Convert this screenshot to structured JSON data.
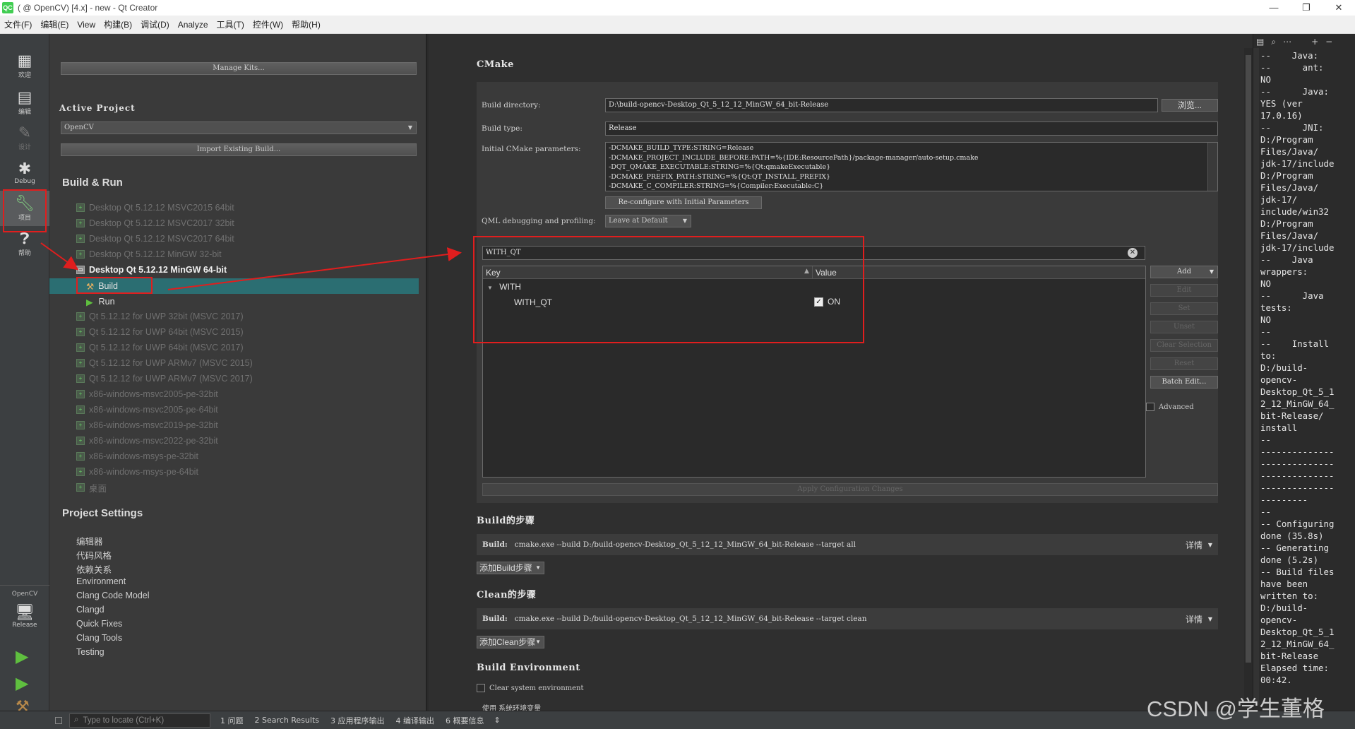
{
  "window": {
    "title": "( @ OpenCV) [4.x] - new - Qt Creator",
    "logo": "QC",
    "controls": [
      "—",
      "❐",
      "✕"
    ]
  },
  "menu": [
    "文件(F)",
    "编辑(E)",
    "View",
    "构建(B)",
    "调试(D)",
    "Analyze",
    "工具(T)",
    "控件(W)",
    "帮助(H)"
  ],
  "modes": {
    "welcome": "欢迎",
    "edit": "编辑",
    "design": "设计",
    "debug": "Debug",
    "projects": "项目",
    "help": "帮助"
  },
  "target": {
    "project": "OpenCV",
    "config": "Release"
  },
  "left": {
    "manage_kits": "Manage Kits...",
    "active_project_title": "Active Project",
    "active_project_value": "OpenCV",
    "import_build": "Import Existing Build...",
    "build_run_title": "Build & Run",
    "kits": [
      "Desktop Qt 5.12.12 MSVC2015 64bit",
      "Desktop Qt 5.12.12 MSVC2017 32bit",
      "Desktop Qt 5.12.12 MSVC2017 64bit",
      "Desktop Qt 5.12.12 MinGW 32-bit",
      "Desktop Qt 5.12.12 MinGW 64-bit",
      "Qt 5.12.12 for UWP 32bit (MSVC 2017)",
      "Qt 5.12.12 for UWP 64bit (MSVC 2015)",
      "Qt 5.12.12 for UWP 64bit (MSVC 2017)",
      "Qt 5.12.12 for UWP ARMv7 (MSVC 2015)",
      "Qt 5.12.12 for UWP ARMv7 (MSVC 2017)",
      "x86-windows-msvc2005-pe-32bit",
      "x86-windows-msvc2005-pe-64bit",
      "x86-windows-msvc2019-pe-32bit",
      "x86-windows-msvc2022-pe-32bit",
      "x86-windows-msys-pe-32bit",
      "x86-windows-msys-pe-64bit",
      "桌面"
    ],
    "build_label": "Build",
    "run_label": "Run",
    "project_settings_title": "Project Settings",
    "settings": [
      "编辑器",
      "代码风格",
      "依赖关系",
      "Environment",
      "Clang Code Model",
      "Clangd",
      "Quick Fixes",
      "Clang Tools",
      "Testing"
    ]
  },
  "cmake": {
    "title": "CMake",
    "build_dir_label": "Build directory:",
    "build_dir_value": "D:\\build-opencv-Desktop_Qt_5_12_12_MinGW_64_bit-Release",
    "browse": "浏览...",
    "build_type_label": "Build type:",
    "build_type_value": "Release",
    "initial_params_label": "Initial CMake parameters:",
    "initial_params": [
      "-DCMAKE_BUILD_TYPE:STRING=Release",
      "-DCMAKE_PROJECT_INCLUDE_BEFORE:PATH=%{IDE:ResourcePath}/package-manager/auto-setup.cmake",
      "-DQT_QMAKE_EXECUTABLE:STRING=%{Qt:qmakeExecutable}",
      "-DCMAKE_PREFIX_PATH:STRING=%{Qt:QT_INSTALL_PREFIX}",
      "-DCMAKE_C_COMPILER:STRING=%{Compiler:Executable:C}"
    ],
    "reconfigure": "Re-configure with Initial Parameters",
    "qml_label": "QML debugging and profiling:",
    "qml_value": "Leave at Default",
    "filter_value": "WITH_QT",
    "col_key": "Key",
    "col_value": "Value",
    "group_with": "WITH",
    "var_name": "WITH_QT",
    "var_value": "ON",
    "buttons": {
      "add": "Add",
      "edit": "Edit",
      "set": "Set",
      "unset": "Unset",
      "clear": "Clear Selection",
      "reset": "Reset",
      "batch": "Batch Edit..."
    },
    "advanced": "Advanced",
    "apply": "Apply Configuration Changes"
  },
  "steps": {
    "build_title": "Build的步骤",
    "build_label": "Build:",
    "build_cmd": "cmake.exe --build D:/build-opencv-Desktop_Qt_5_12_12_MinGW_64_bit-Release --target all",
    "details": "详情",
    "add_build": "添加Build步骤",
    "clean_title": "Clean的步骤",
    "clean_label": "Build:",
    "clean_cmd": "cmake.exe --build D:/build-opencv-Desktop_Qt_5_12_12_MinGW_64_bit-Release --target clean",
    "add_clean": "添加Clean步骤",
    "env_title": "Build Environment",
    "clear_env": "Clear system environment",
    "use_sys": "使用 系统环境变量"
  },
  "log": "--    Java:\n--      ant:\nNO\n--      Java:\nYES (ver\n17.0.16)\n--      JNI:\nD:/Program\nFiles/Java/\njdk-17/include\nD:/Program\nFiles/Java/\njdk-17/\ninclude/win32\nD:/Program\nFiles/Java/\njdk-17/include\n--    Java\nwrappers:\nNO\n--      Java\ntests:\nNO\n--\n--    Install\nto:\nD:/build-\nopencv-\nDesktop_Qt_5_1\n2_12_MinGW_64_\nbit-Release/\ninstall\n--\n--------------\n--------------\n--------------\n--------------\n---------\n--\n-- Configuring\ndone (35.8s)\n-- Generating\ndone (5.2s)\n-- Build files\nhave been\nwritten to:\nD:/build-\nopencv-\nDesktop_Qt_5_1\n2_12_MinGW_64_\nbit-Release\nElapsed time:\n00:42.",
  "status": {
    "locate_placeholder": "Type to locate (Ctrl+K)",
    "tabs": [
      "1  问题",
      "2  Search Results",
      "3  应用程序输出",
      "4  编译输出",
      "6  概要信息"
    ]
  },
  "watermark": "CSDN @学生董格",
  "colors": {
    "accent": "#2b6e72",
    "red": "#e01e1e",
    "bg": "#2f2f2f"
  }
}
